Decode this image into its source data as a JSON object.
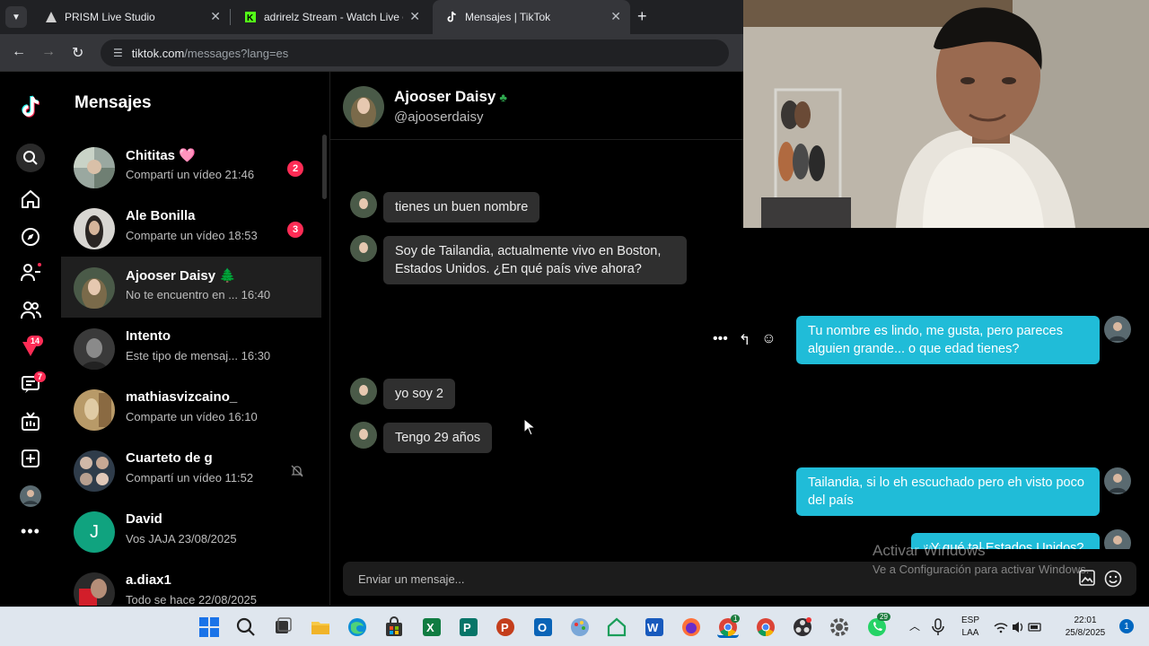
{
  "browser": {
    "tabs": [
      {
        "title": "PRISM Live Studio",
        "active": false
      },
      {
        "title": "adrirelz Stream - Watch Live on",
        "active": false
      },
      {
        "title": "Mensajes | TikTok",
        "active": true
      }
    ],
    "url_host": "tiktok.com",
    "url_path": "/messages?lang=es"
  },
  "rail": {
    "badges": {
      "activity": "14",
      "inbox": "7"
    }
  },
  "convlist": {
    "title": "Mensajes",
    "items": [
      {
        "name": "Chititas 🩷",
        "preview": "Compartí un vídeo 21:46",
        "unread": "2",
        "selected": false
      },
      {
        "name": "Ale Bonilla",
        "preview": "Comparte un vídeo 18:53",
        "unread": "3",
        "selected": false
      },
      {
        "name": "Ajooser Daisy 🌲",
        "preview": "No te encuentro en ... 16:40",
        "unread": "",
        "selected": true
      },
      {
        "name": "Intento",
        "preview": "Este tipo de mensaj... 16:30",
        "unread": "",
        "selected": false
      },
      {
        "name": "mathiasvizcaino_",
        "preview": "Comparte un vídeo 16:10",
        "unread": "",
        "selected": false
      },
      {
        "name": "Cuarteto de g",
        "preview": "Compartí un vídeo 11:52",
        "unread": "",
        "muted": true,
        "selected": false
      },
      {
        "name": "David",
        "preview": "Vos JAJA 23/08/2025",
        "unread": "",
        "initial": "J",
        "selected": false
      },
      {
        "name": "a.diax1",
        "preview": "Todo se hace 22/08/2025",
        "unread": "",
        "selected": false
      }
    ]
  },
  "chat": {
    "contact_name": "Ajooser Daisy",
    "contact_handle": "@ajooserdaisy",
    "messages": [
      {
        "dir": "in",
        "text": "tienes un buen nombre"
      },
      {
        "dir": "in",
        "text": "Soy de Tailandia, actualmente vivo en Boston, Estados Unidos. ¿En qué país vive ahora?"
      },
      {
        "dir": "out",
        "text": "Tu nombre es lindo, me gusta, pero pareces alguien grande... o que edad tienes?"
      },
      {
        "dir": "in",
        "text": "yo soy 2"
      },
      {
        "dir": "in",
        "text": "Tengo 29 años"
      },
      {
        "dir": "out",
        "text": "Tailandia, si lo eh escuchado pero eh visto poco del país"
      },
      {
        "dir": "out",
        "text": "¿Y qué tal Estados Unidos?"
      }
    ],
    "composer_placeholder": "Enviar un mensaje..."
  },
  "watermark": {
    "line1": "Activar Windows",
    "line2": "Ve a Configuración para activar Windows."
  },
  "taskbar": {
    "lang_top": "ESP",
    "lang_bottom": "LAA",
    "time": "22:01",
    "date": "25/8/2025",
    "notifications": "1",
    "whatsapp_badge": "29",
    "chrome_badge": "1"
  }
}
